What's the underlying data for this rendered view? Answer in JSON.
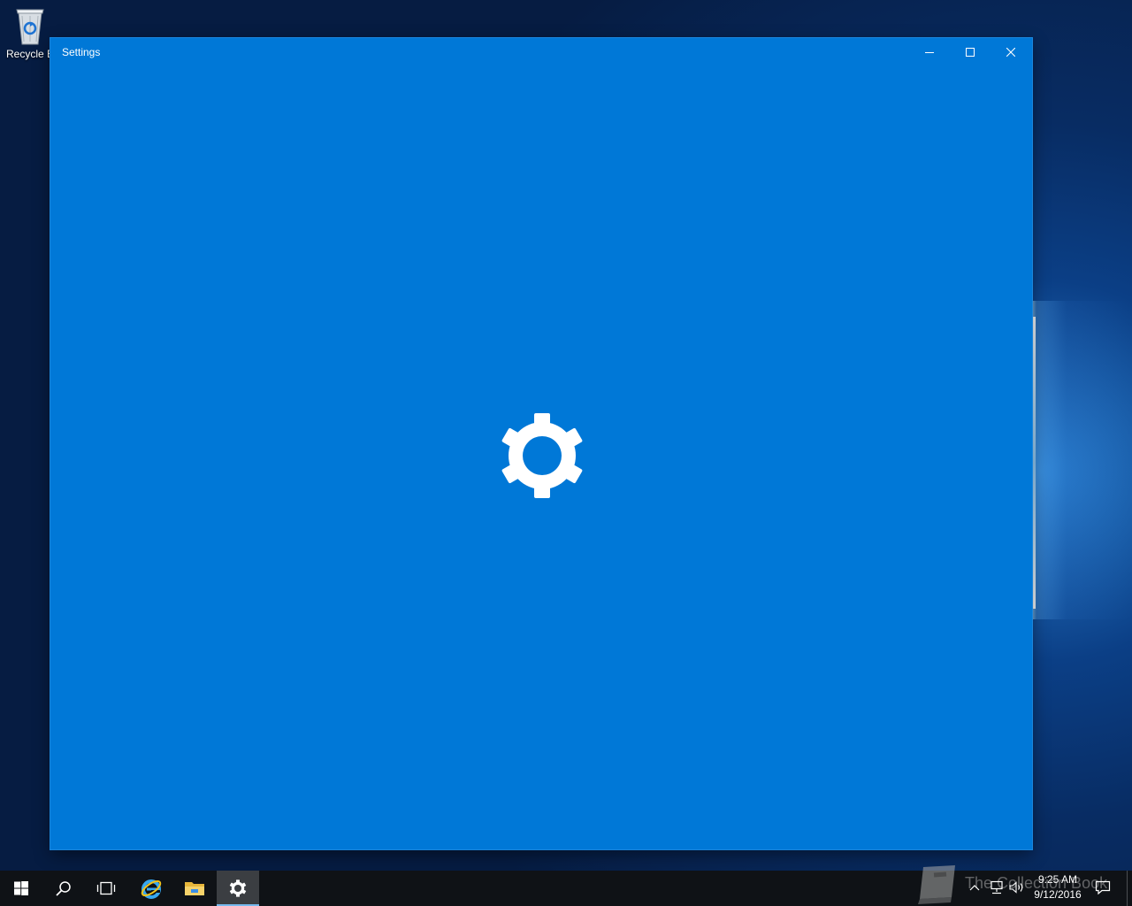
{
  "desktop": {
    "icons": [
      {
        "label": "Recycle Bin",
        "icon": "recycle-bin-icon"
      }
    ]
  },
  "window": {
    "title": "Settings",
    "background": "#0078d7",
    "controls": {
      "minimize_icon": "minimize-icon",
      "maximize_icon": "maximize-icon",
      "close_icon": "close-icon"
    },
    "splash_icon": "gear-icon"
  },
  "taskbar": {
    "items": [
      {
        "name": "start",
        "icon": "windows-logo-icon"
      },
      {
        "name": "search",
        "icon": "search-icon"
      },
      {
        "name": "task-view",
        "icon": "task-view-icon"
      },
      {
        "name": "internet-explorer",
        "icon": "internet-explorer-icon"
      },
      {
        "name": "file-explorer",
        "icon": "folder-icon"
      },
      {
        "name": "settings",
        "icon": "gear-icon",
        "active": true
      }
    ],
    "watermark": "The Collection Book",
    "tray": {
      "icons": [
        "chevron-up-icon",
        "network-icon",
        "volume-icon",
        "notification-icon"
      ],
      "time": "9:25 AM",
      "date": "9/12/2016"
    }
  },
  "colors": {
    "accent": "#0078d7",
    "taskbar": "#0f1216",
    "active_indicator": "#76b9ed"
  }
}
